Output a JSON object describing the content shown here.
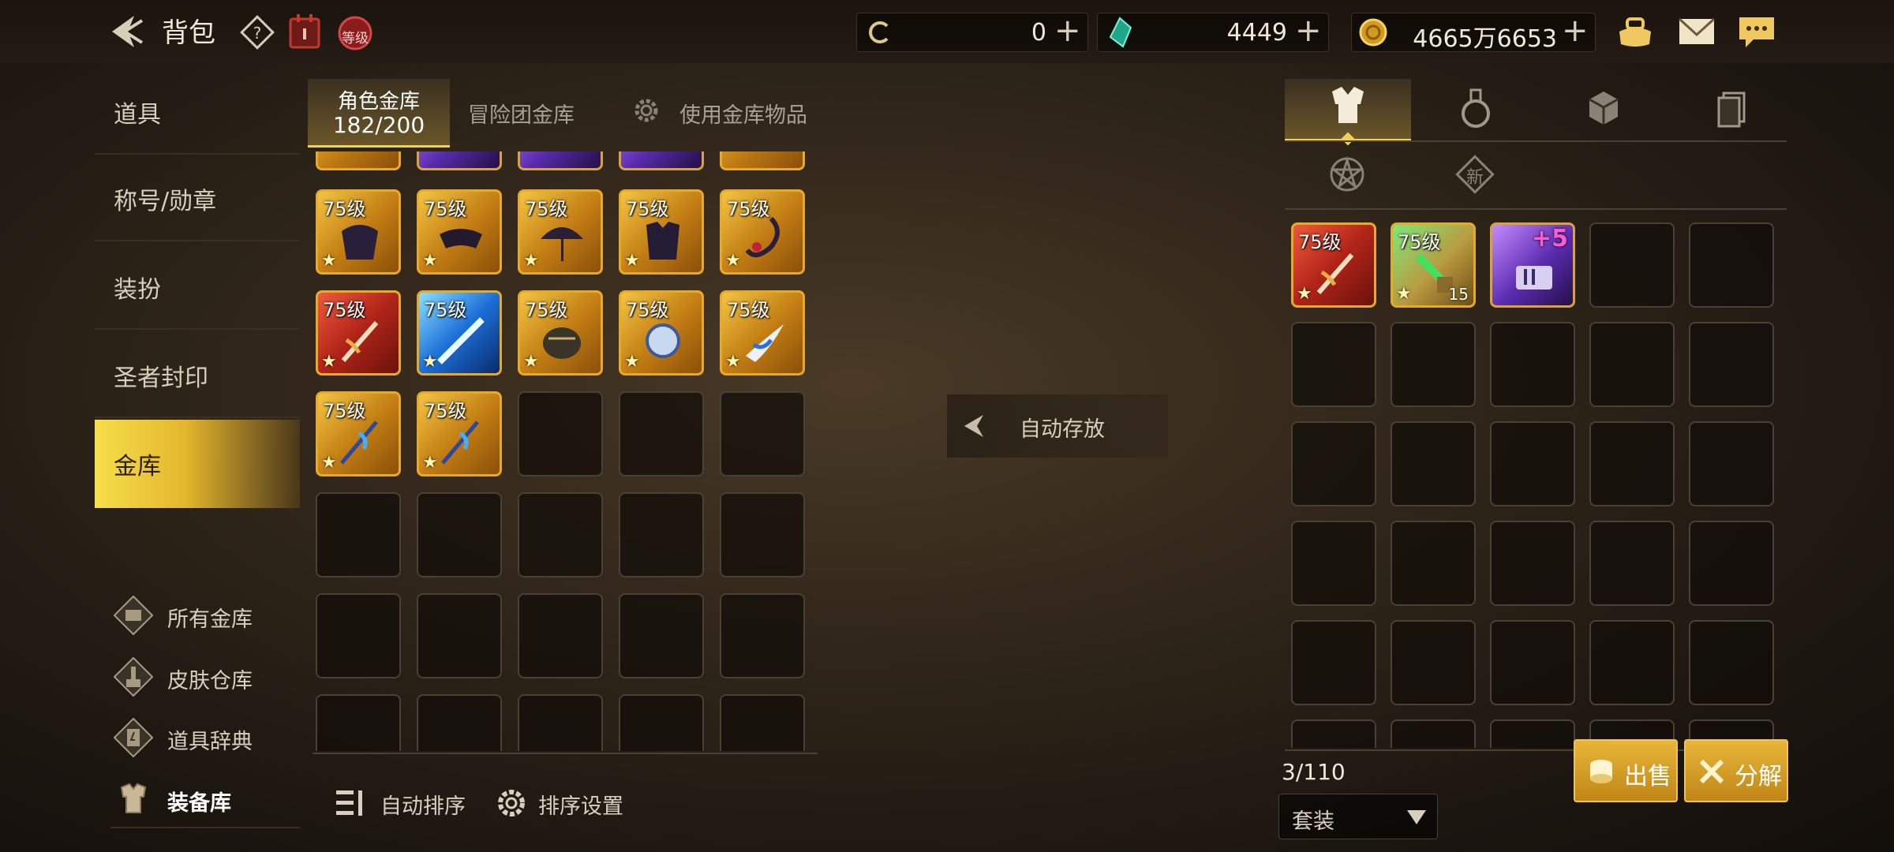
{
  "header": {
    "title": "背包",
    "level_badge": "等级",
    "currencies": [
      {
        "name": "c-coin",
        "value": "0"
      },
      {
        "name": "green-crystal",
        "value": "4449"
      },
      {
        "name": "gold",
        "value": "4665万6653"
      }
    ]
  },
  "sidebar": {
    "items": [
      {
        "label": "道具"
      },
      {
        "label": "称号/勋章"
      },
      {
        "label": "装扮"
      },
      {
        "label": "圣者封印"
      },
      {
        "label": "金库"
      }
    ],
    "sub_items": [
      {
        "label": "所有金库"
      },
      {
        "label": "皮肤仓库"
      },
      {
        "label": "道具辞典"
      },
      {
        "label": "装备库"
      }
    ]
  },
  "vault": {
    "tab_active_label": "角色金库",
    "capacity": "182/200",
    "tab_adventure": "冒险团金库",
    "tab_use": "使用金库物品",
    "auto_sort": "自动排序",
    "sort_settings": "排序设置",
    "auto_store": "自动存放"
  },
  "grid_items": {
    "level": "75级"
  },
  "inventory": {
    "new_badge": "新",
    "count": "3/110",
    "stack_count": "15",
    "enhance": "+5",
    "filter_value": "套装",
    "sell": "出售",
    "dismantle": "分解"
  },
  "colors": {
    "accent": "#e8b63a",
    "active_menu": "#f6df4a"
  }
}
